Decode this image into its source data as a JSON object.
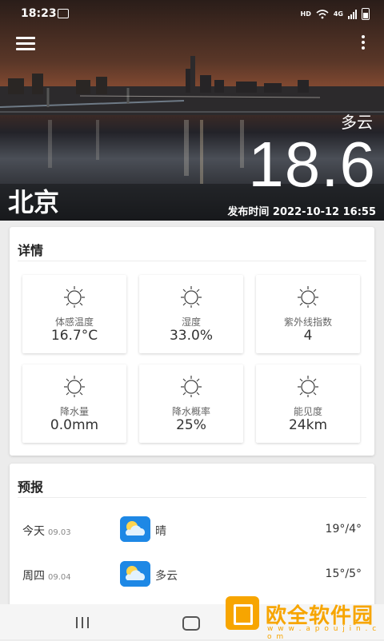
{
  "status_bar": {
    "time": "18:23",
    "network": "HD",
    "cell": "4G"
  },
  "header": {
    "location": "北京",
    "condition": "多云",
    "temperature": "18.6",
    "publish_time": "发布时间 2022-10-12 16:55"
  },
  "details": {
    "title": "详情",
    "items": [
      {
        "label": "体感温度",
        "value": "16.7°C"
      },
      {
        "label": "湿度",
        "value": "33.0%"
      },
      {
        "label": "紫外线指数",
        "value": "4"
      },
      {
        "label": "降水量",
        "value": "0.0mm"
      },
      {
        "label": "降水概率",
        "value": "25%"
      },
      {
        "label": "能见度",
        "value": "24km"
      }
    ]
  },
  "forecast": {
    "title": "预报",
    "rows": [
      {
        "day": "今天",
        "date": "09.03",
        "condition": "晴",
        "range": "19°/4°"
      },
      {
        "day": "周四",
        "date": "09.04",
        "condition": "多云",
        "range": "15°/5°"
      }
    ]
  },
  "watermark": {
    "name": "欧全软件园",
    "url": "w w w . a p o u j i n . c o m"
  },
  "colors": {
    "accent_blue": "#1e88e5",
    "watermark_orange": "#f7a500"
  }
}
